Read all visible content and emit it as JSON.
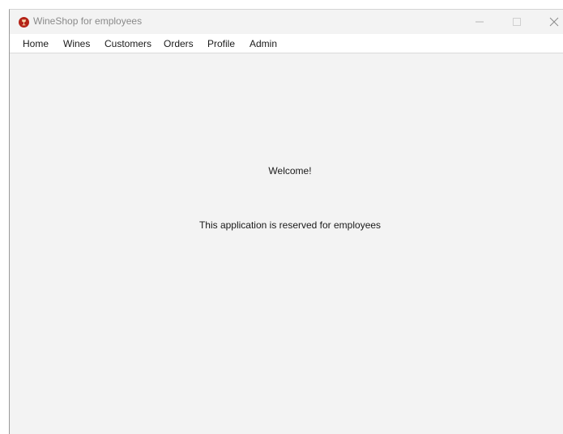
{
  "window": {
    "title": "WineShop for employees",
    "icon": "wine-glass-icon",
    "controls": [
      "minimize-icon",
      "maximize-icon",
      "close-icon"
    ]
  },
  "menu": {
    "items": [
      {
        "label": "Home"
      },
      {
        "label": "Wines"
      },
      {
        "label": "Customers"
      },
      {
        "label": "Orders"
      },
      {
        "label": "Profile"
      },
      {
        "label": "Admin"
      }
    ]
  },
  "content": {
    "welcome": "Welcome!",
    "message": "This application is reserved for employees"
  },
  "colors": {
    "window_bg": "#f3f3f3",
    "menubar_bg": "#ffffff",
    "icon_red": "#b42318",
    "title_text": "#8a8a8a"
  }
}
